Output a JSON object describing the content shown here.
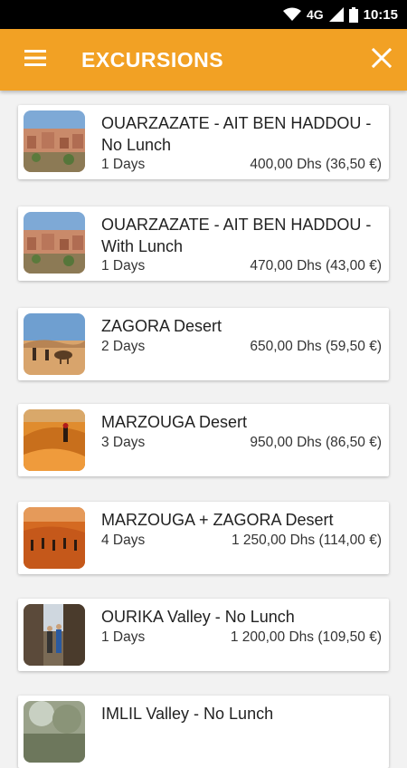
{
  "status_bar": {
    "network": "4G",
    "time": "10:15"
  },
  "app_bar": {
    "title": "EXCURSIONS"
  },
  "excursions": [
    {
      "name": "OUARZAZATE - AIT BEN HADDOU - No Lunch",
      "duration": "1 Days",
      "price": "400,00 Dhs (36,50 €)",
      "thumb_icon": "city-thumbnail"
    },
    {
      "name": "OUARZAZATE - AIT BEN HADDOU - With Lunch",
      "duration": "1 Days",
      "price": "470,00 Dhs (43,00 €)",
      "thumb_icon": "city-thumbnail"
    },
    {
      "name": "ZAGORA Desert",
      "duration": "2 Days",
      "price": "650,00 Dhs (59,50 €)",
      "thumb_icon": "camel-desert-thumbnail"
    },
    {
      "name": "MARZOUGA Desert",
      "duration": "3 Days",
      "price": "950,00 Dhs (86,50 €)",
      "thumb_icon": "dunes-thumbnail"
    },
    {
      "name": "MARZOUGA + ZAGORA Desert",
      "duration": "4 Days",
      "price": "1 250,00 Dhs (114,00 €)",
      "thumb_icon": "camel-caravan-thumbnail"
    },
    {
      "name": "OURIKA Valley - No Lunch",
      "duration": "1 Days",
      "price": "1 200,00 Dhs (109,50 €)",
      "thumb_icon": "valley-thumbnail"
    },
    {
      "name": "IMLIL Valley - No Lunch",
      "duration": "",
      "price": "",
      "thumb_icon": "mountain-thumbnail"
    }
  ],
  "colors": {
    "accent": "#f2a124",
    "status_bar": "#000000"
  }
}
